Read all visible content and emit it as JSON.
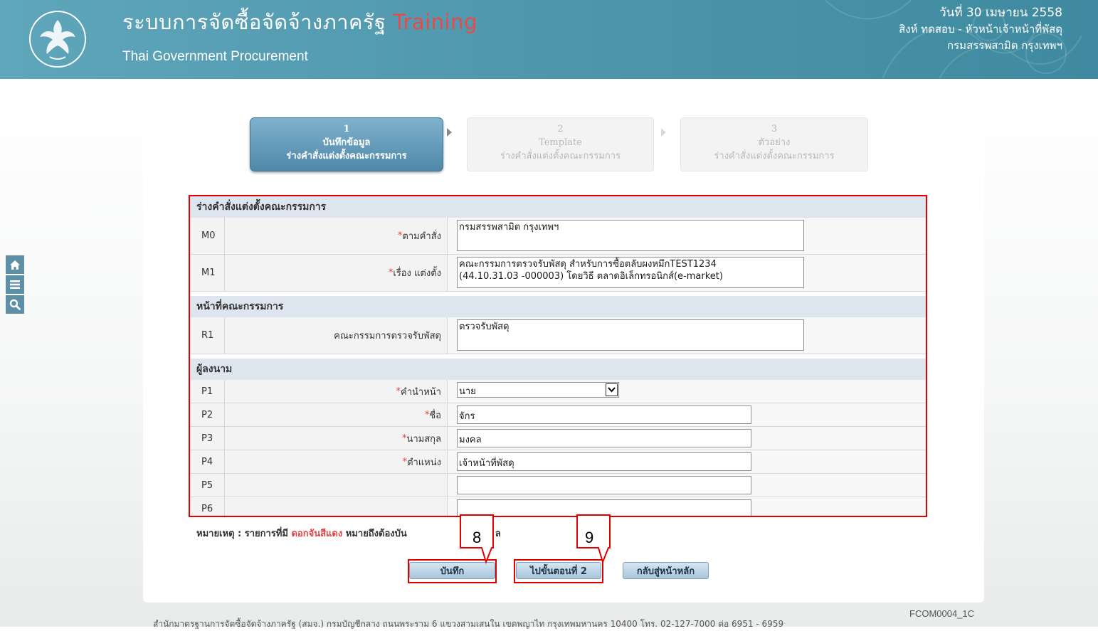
{
  "header": {
    "title": "ระบบการจัดซื้อจัดจ้างภาครัฐ",
    "title_badge": "Training",
    "subtitle": "Thai Government Procurement",
    "date": "วันที่ 30 เมษายน 2558",
    "user": "สิงห์ ทดสอบ - หัวหน้าเจ้าหน้าที่พัสดุ",
    "department": "กรมสรรพสามิต กรุงเทพฯ"
  },
  "sidebar": {
    "icons": [
      "home-icon",
      "menu-icon",
      "search-icon"
    ]
  },
  "steps": [
    {
      "number": "1",
      "title": "บันทึกข้อมูล",
      "subtitle": "ร่างคำสั่งแต่งตั้งคณะกรรมการ",
      "active": true
    },
    {
      "number": "2",
      "title": "Template",
      "subtitle": "ร่างคำสั่งแต่งตั้งคณะกรรมการ",
      "active": false
    },
    {
      "number": "3",
      "title": "ตัวอย่าง",
      "subtitle": "ร่างคำสั่งแต่งตั้งคณะกรรมการ",
      "active": false
    }
  ],
  "form": {
    "section1": {
      "title": "ร่างคำสั่งแต่งตั้งคณะกรรมการ",
      "rows": [
        {
          "code": "M0",
          "required": "*",
          "label": "ตามคำสั่ง",
          "value": "กรมสรรพสามิต กรุงเทพฯ"
        },
        {
          "code": "M1",
          "required": "*",
          "label": "เรื่อง แต่งตั้ง",
          "value": "คณะกรรมการตรวจรับพัสดุ สำหรับการซื้อตลับผงหมึกTEST1234\n(44.10.31.03 -000003) โดยวิธี ตลาดอิเล็กทรอนิกส์(e-market)"
        }
      ]
    },
    "section2": {
      "title": "หน้าที่คณะกรรมการ",
      "rows": [
        {
          "code": "R1",
          "label": "คณะกรรมการตรวจรับพัสดุ",
          "value": "ตรวจรับพัสดุ"
        }
      ]
    },
    "section3": {
      "title": "ผู้ลงนาม",
      "rows": [
        {
          "code": "P1",
          "required": "*",
          "label": "คำนำหน้า",
          "value": "นาย"
        },
        {
          "code": "P2",
          "required": "*",
          "label": "ชื่อ",
          "value": "จักร"
        },
        {
          "code": "P3",
          "required": "*",
          "label": "นามสกุล",
          "value": "มงคล"
        },
        {
          "code": "P4",
          "required": "*",
          "label": "ตำแหน่ง",
          "value": "เจ้าหน้าที่พัสดุ"
        },
        {
          "code": "P5",
          "label": "",
          "value": ""
        },
        {
          "code": "P6",
          "label": "",
          "value": ""
        }
      ]
    }
  },
  "note": {
    "prefix": "หมายเหตุ : รายการที่มี",
    "highlight": "ดอกจันสีแดง",
    "suffix": "หมายถึงต้องบัน",
    "tail": "ล"
  },
  "buttons": {
    "save": "บันทึก",
    "next": "ไปขั้นตอนที่ 2",
    "back": "กลับสู่หน้าหลัก"
  },
  "callouts": {
    "save": "8",
    "next": "9"
  },
  "footer": {
    "code": "FCOM0004_1C",
    "text": "สำนักมาตรฐานการจัดซื้อจัดจ้างภาครัฐ (สมจ.) กรมบัญชีกลาง ถนนพระราม 6 แขวงสามเสนใน เขตพญาไท กรุงเทพมหานคร 10400 โทร. 02-127-7000 ต่อ 6951 - 6959"
  },
  "colors": {
    "header": "#4d95ab",
    "required": "#e04444",
    "highlight_border": "#e00000",
    "active_step": "#4f88a9",
    "section_header": "#dde6ee"
  }
}
